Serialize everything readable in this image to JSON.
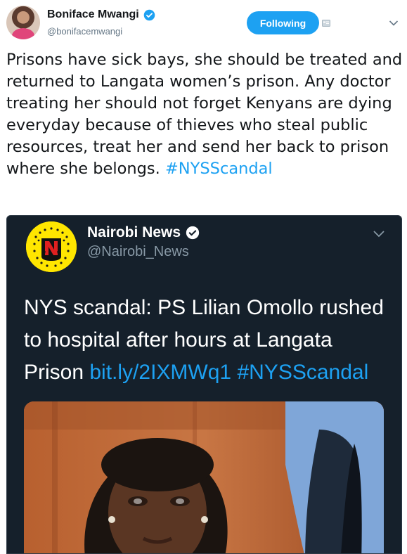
{
  "tweet": {
    "author": {
      "display_name": "Boniface Mwangi",
      "handle": "@bonifacemwangi",
      "verified": true
    },
    "follow_button": {
      "label": "Following"
    },
    "text_before_hashtag": "Prisons have sick bays, she should be treated and returned to Langata women’s prison. Any doctor treating her should not forget Kenyans are dying everyday because of thieves who steal public resources, treat her and send her back to prison where she belongs. ",
    "hashtag": "#NYSScandal"
  },
  "quoted_tweet": {
    "author": {
      "display_name": "Nairobi News",
      "handle": "@Nairobi_News",
      "verified": true
    },
    "text_before_link": "NYS scandal: PS Lilian Omollo rushed to hospital after hours at Langata Prison ",
    "link": "bit.ly/2IXMWq1",
    "hashtag": "#NYSScandal"
  },
  "colors": {
    "accent": "#1da1f2",
    "text": "#14171a",
    "secondary": "#657786",
    "card_bg": "#15202b"
  }
}
